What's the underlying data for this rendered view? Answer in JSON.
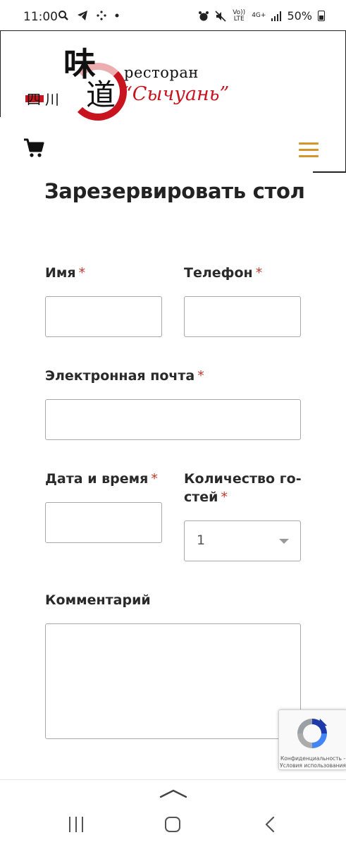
{
  "status_bar": {
    "time": "11:00",
    "left_icons": [
      "search-icon",
      "telegram-icon",
      "dots-icon",
      "dot-icon"
    ],
    "volte": "Vo)) LTE",
    "network": "4G+",
    "battery": "50%"
  },
  "header": {
    "logo": {
      "char_taste": "味",
      "char_way": "道",
      "char_sichuan": "四川",
      "word": "ресторан",
      "name": "“Сычуань”"
    },
    "cart_icon": "cart-icon",
    "menu_icon": "hamburger-menu-icon",
    "accent": "#d4952a"
  },
  "page": {
    "title": "Зарезервировать стол"
  },
  "form": {
    "required_mark": "*",
    "name_label": "Имя",
    "phone_label": "Телефон",
    "email_label": "Электронная почта",
    "datetime_label": "Дата и время",
    "guests_label_line1": "Количество го-",
    "guests_label_line2": "стей",
    "guests_value": "1",
    "comment_label": "Комментарий",
    "required_color": "#c0392b"
  },
  "recaptcha": {
    "privacy": "Конфиденциальность -",
    "terms": "Условия использования"
  },
  "nav_bar": {
    "up_icon": "chevron-up-icon",
    "recent_icon": "recent-apps-icon",
    "home_icon": "home-icon",
    "back_icon": "back-icon"
  }
}
